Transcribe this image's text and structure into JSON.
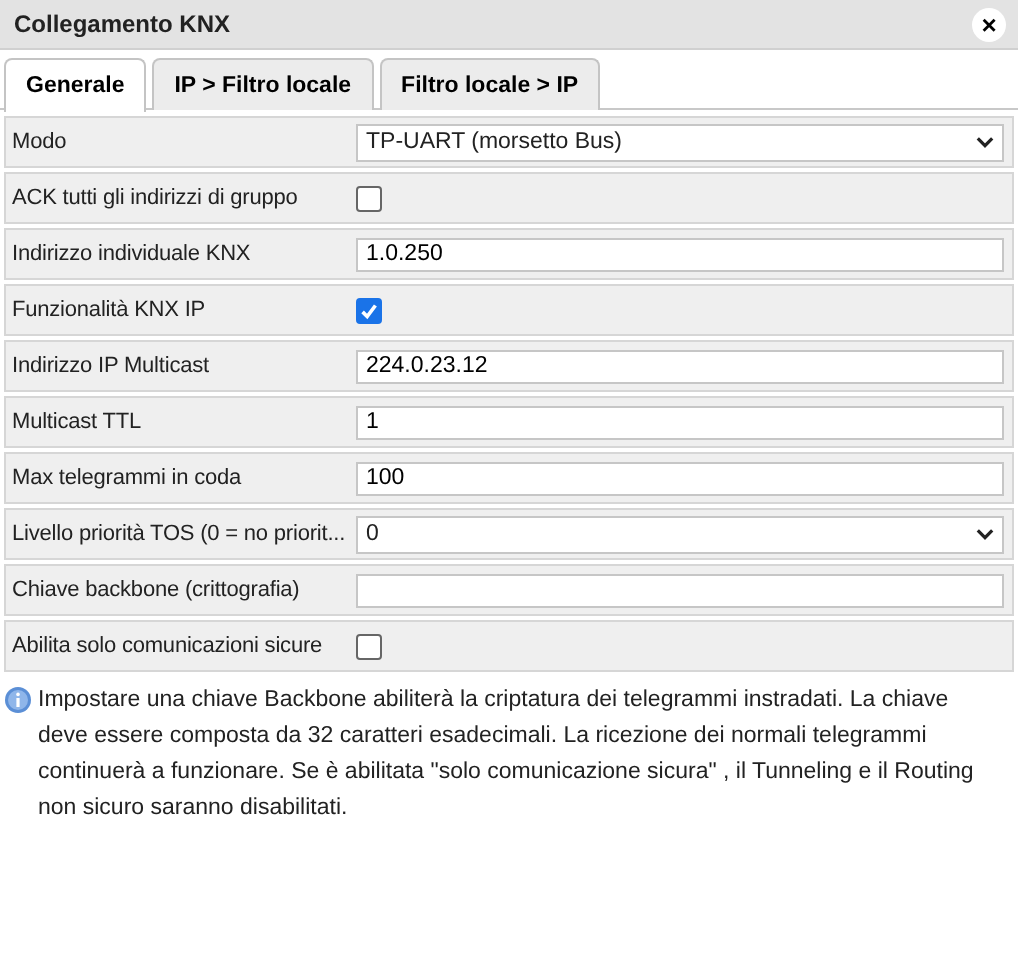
{
  "window": {
    "title": "Collegamento KNX",
    "close": "×"
  },
  "tabs": [
    {
      "label": "Generale",
      "selected": true
    },
    {
      "label": "IP > Filtro locale",
      "selected": false
    },
    {
      "label": "Filtro locale > IP",
      "selected": false
    }
  ],
  "rows": [
    {
      "label": "Modo",
      "kind": "select",
      "value": "TP-UART (morsetto Bus)"
    },
    {
      "label": "ACK tutti gli indirizzi di gruppo",
      "kind": "checkbox",
      "checked": false
    },
    {
      "label": "Indirizzo individuale KNX",
      "kind": "text",
      "value": "1.0.250"
    },
    {
      "label": "Funzionalità KNX IP",
      "kind": "checkbox",
      "checked": true
    },
    {
      "label": "Indirizzo IP Multicast",
      "kind": "text",
      "value": "224.0.23.12"
    },
    {
      "label": "Multicast TTL",
      "kind": "text",
      "value": "1"
    },
    {
      "label": "Max telegrammi in coda",
      "kind": "text",
      "value": "100"
    },
    {
      "label": "Livello priorità TOS (0 = no priorit...",
      "kind": "select",
      "value": "0"
    },
    {
      "label": "Chiave backbone (crittografia)",
      "kind": "text"
    },
    {
      "label": "Abilita solo comunicazioni sicure",
      "kind": "checkbox",
      "checked": false
    }
  ],
  "info": "Impostare una chiave Backbone abiliterà la criptatura dei telegrammi instradati. La chiave deve essere composta da 32 caratteri esadecimali. La ricezione dei normali telegrammi continuerà a funzionare. Se è abilitata \"solo comunicazione sicura\" , il Tunneling e il Routing non sicuro saranno disabilitati."
}
